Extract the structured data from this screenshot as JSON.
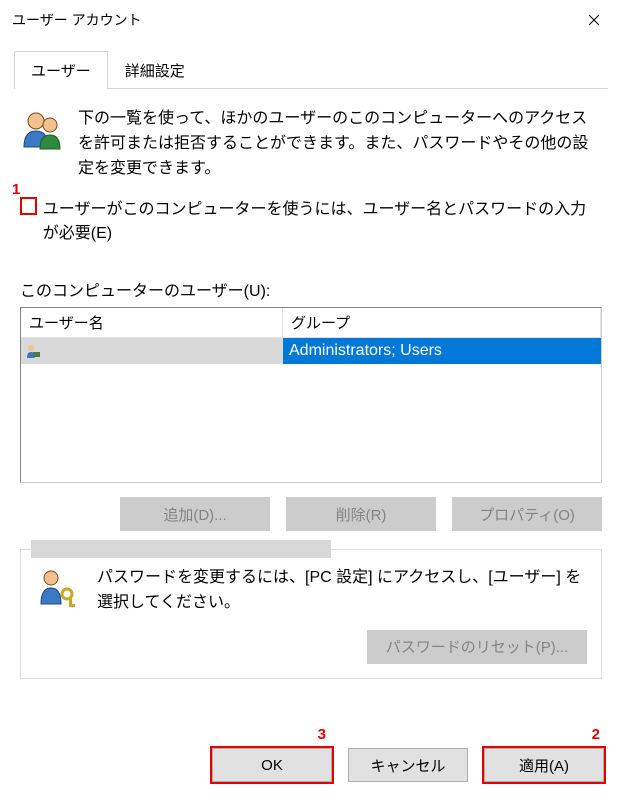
{
  "window": {
    "title": "ユーザー アカウント"
  },
  "tabs": {
    "users": "ユーザー",
    "advanced": "詳細設定"
  },
  "intro": {
    "text": "下の一覧を使って、ほかのユーザーのこのコンピューターへのアクセスを許可または拒否することができます。また、パスワードやその他の設定を変更できます。"
  },
  "checkbox": {
    "label": "ユーザーがこのコンピューターを使うには、ユーザー名とパスワードの入力が必要(E)"
  },
  "userlist": {
    "label": "このコンピューターのユーザー(U):",
    "columns": {
      "user": "ユーザー名",
      "group": "グループ"
    },
    "rows": [
      {
        "user": "",
        "group": "Administrators; Users"
      }
    ]
  },
  "buttons": {
    "add": "追加(D)...",
    "remove": "削除(R)",
    "properties": "プロパティ(O)"
  },
  "password_panel": {
    "text": "パスワードを変更するには、[PC 設定] にアクセスし、[ユーザー] を選択してください。",
    "reset_button": "パスワードのリセット(P)..."
  },
  "footer": {
    "ok": "OK",
    "cancel": "キャンセル",
    "apply": "適用(A)"
  },
  "annotations": {
    "n1": "1",
    "n2": "2",
    "n3": "3"
  }
}
